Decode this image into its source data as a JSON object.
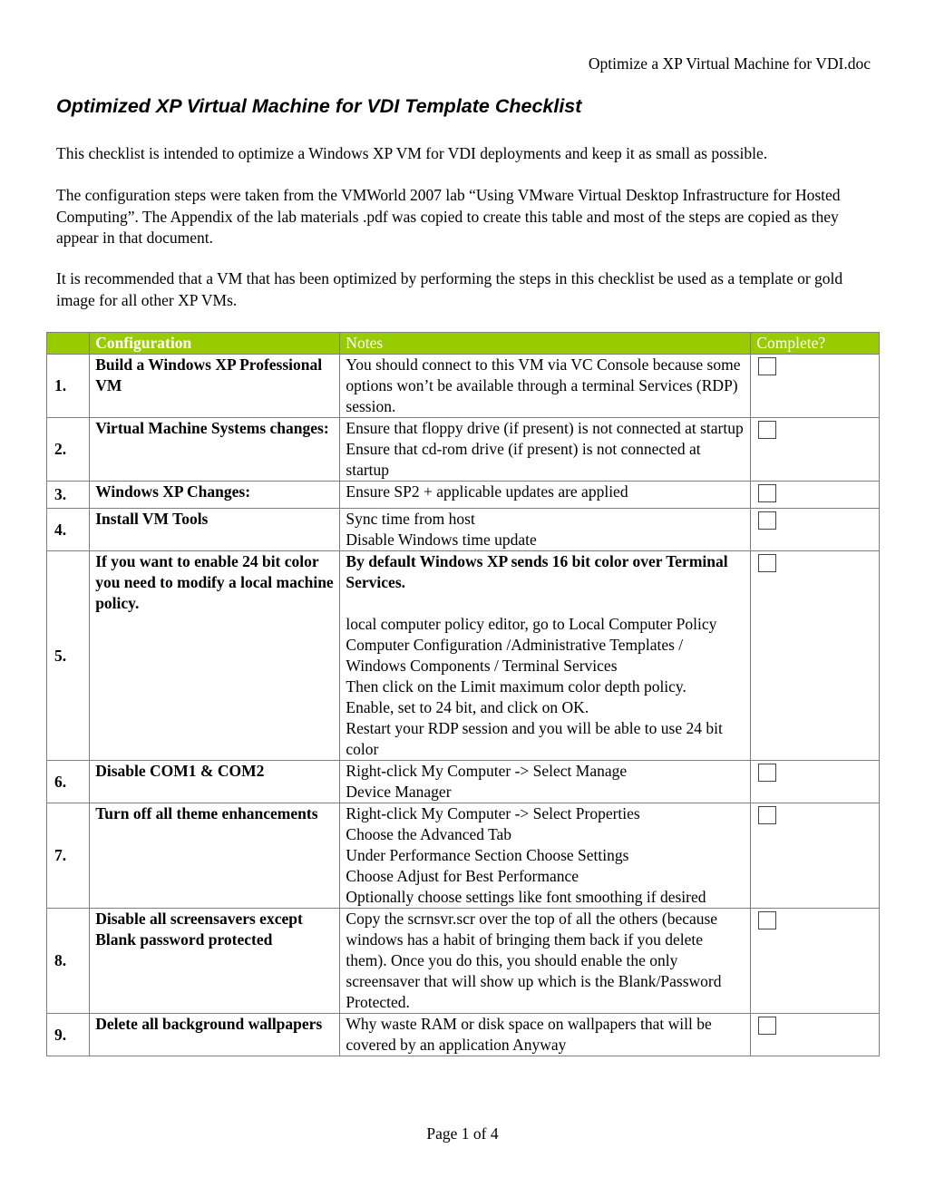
{
  "header": {
    "doc_name": "Optimize a XP Virtual Machine for VDI.doc"
  },
  "title": "Optimized XP Virtual Machine for VDI Template Checklist",
  "intro": [
    "This checklist is intended to optimize a Windows XP VM for VDI deployments and keep it as small as possible.",
    "The configuration steps were taken from the VMWorld 2007 lab “Using VMware Virtual Desktop Infrastructure for Hosted Computing”. The Appendix of the lab materials .pdf was copied to create this table and most of the steps are copied as they appear in that document.",
    "It is recommended that a VM that has been optimized by performing the steps in this checklist be used as a template or gold image for all other XP VMs."
  ],
  "table": {
    "accent_color": "#99cc00",
    "columns": [
      "",
      "Configuration",
      "Notes",
      "Complete?"
    ],
    "rows": [
      {
        "num": "1.",
        "config": "Build a Windows XP Professional VM",
        "notes": [
          "You should connect to this VM via VC Console because some options won’t be available through a terminal Services (RDP) session."
        ],
        "complete": false
      },
      {
        "num": "2.",
        "config": "Virtual Machine Systems changes:",
        "notes": [
          "Ensure that floppy drive (if present) is not connected at startup",
          "Ensure that cd-rom drive (if present) is not connected at startup"
        ],
        "complete": false
      },
      {
        "num": "3.",
        "config": "Windows XP Changes:",
        "notes": [
          "Ensure SP2 + applicable updates are applied"
        ],
        "complete": false
      },
      {
        "num": "4.",
        "config": "Install VM Tools",
        "notes": [
          "Sync time from host",
          "Disable Windows time update"
        ],
        "complete": false
      },
      {
        "num": "5.",
        "config": "If you want to enable 24 bit color you need to modify a local machine policy.",
        "notes_bold": "By default Windows XP sends 16 bit color over Terminal Services.",
        "notes": [
          "local computer policy editor, go to Local Computer Policy",
          "Computer Configuration /Administrative Templates / Windows Components / Terminal Services",
          "Then click on the Limit maximum color depth policy.",
          "Enable, set to 24 bit, and click on OK.",
          "Restart your RDP session and you will be able to use 24 bit color"
        ],
        "complete": false
      },
      {
        "num": "6.",
        "config": "Disable COM1 & COM2",
        "notes": [
          "Right-click My Computer -> Select Manage",
          "Device Manager"
        ],
        "complete": false
      },
      {
        "num": "7.",
        "config": "Turn off all theme enhancements",
        "notes": [
          "Right-click My Computer -> Select Properties",
          "Choose the Advanced Tab",
          "Under Performance Section Choose Settings",
          "Choose Adjust for Best Performance",
          "Optionally choose settings like font smoothing if desired"
        ],
        "complete": false
      },
      {
        "num": "8.",
        "config": "Disable all screensavers except Blank password protected",
        "notes": [
          "Copy the scrnsvr.scr over the top of all the others (because windows has a habit of bringing them back if you delete them).  Once you do this, you should enable the only screensaver that will show up which is the Blank/Password Protected."
        ],
        "complete": false
      },
      {
        "num": "9.",
        "config": "Delete all background wallpapers",
        "notes": [
          "Why waste RAM or disk space on wallpapers that will be covered by an application Anyway"
        ],
        "complete": false
      }
    ]
  },
  "footer": {
    "page": "Page 1 of 4"
  }
}
